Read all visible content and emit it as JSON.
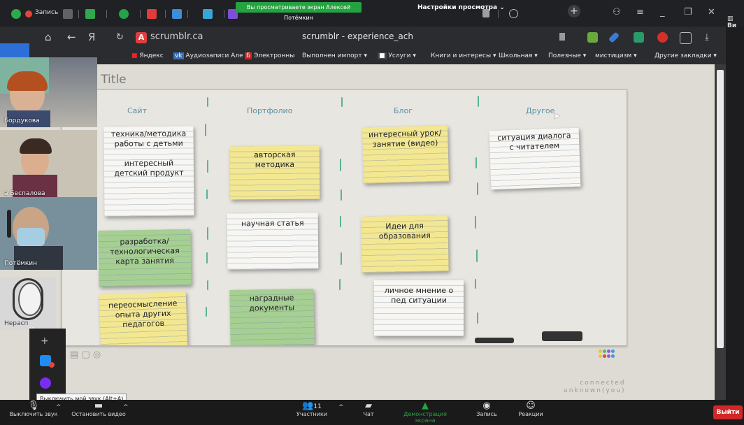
{
  "tabs": {
    "share_banner": "Вы просматриваете экран Алексей Потёмкин",
    "view_settings": "Настройки просмотра",
    "recording_tab": "Запись"
  },
  "browser": {
    "url": "scrumblr.ca",
    "page_title": "scrumblr - experience_ach",
    "right_bookmark": "Ви"
  },
  "bookmarks": {
    "items": [
      "Яндекс",
      "Аудиозаписи Але",
      "Электронны",
      "Выполнен импорт",
      "Услуги",
      "Книги и интересы",
      "Школьная",
      "Полезные",
      "мистицизм"
    ],
    "other": "Другие закладки"
  },
  "board": {
    "title": "d Title",
    "columns": [
      "Сайт",
      "Портфолио",
      "Блог",
      "Другое"
    ],
    "cards": [
      {
        "text": "техника/методика работы с детьми интересный детский продукт",
        "color": "white"
      },
      {
        "text": "разработка/ технологическая карта занятия",
        "color": "green"
      },
      {
        "text": "переосмысление опыта других педагогов",
        "color": "yellow"
      },
      {
        "text": "авторская методика",
        "color": "yellow"
      },
      {
        "text": "научная статья",
        "color": "white"
      },
      {
        "text": "наградные документы",
        "color": "green"
      },
      {
        "text": "интересный урок/ занятие (видео)",
        "color": "yellow"
      },
      {
        "text": "Идеи для образования",
        "color": "yellow"
      },
      {
        "text": "личное мнение о пед ситуации",
        "color": "white"
      },
      {
        "text": "ситуация диалога с читателем",
        "color": "white"
      }
    ],
    "card_lines": {
      "c1a": "техника/методика",
      "c1b": "работы с детьми",
      "c1c": "интересный",
      "c1d": "детский продукт",
      "c2a": "разработка/",
      "c2b": "технологическая",
      "c2c": "карта занятия",
      "c3a": "переосмысление",
      "c3b": "опыта других",
      "c3c": "педагогов",
      "c4a": "авторская",
      "c4b": "методика",
      "c5a": "научная статья",
      "c6a": "наградные",
      "c6b": "документы",
      "c7a": "интересный урок/",
      "c7b": "занятие (видео)",
      "c8a": "Идеи для",
      "c8b": "образования",
      "c9a": "личное мнение о",
      "c9b": "пед ситуации",
      "c10a": "ситуация диалога",
      "c10b": "с читателем"
    },
    "connected_line1": "connected",
    "connected_line2": "unknown(you)"
  },
  "participants": [
    {
      "name": "Бордукова"
    },
    {
      "name": "а Беспалова"
    },
    {
      "name": "Потёмкин"
    },
    {
      "name": "Нерасп"
    }
  ],
  "tooltip": "Выключить мой звук (Alt+A)",
  "zoom_bar": {
    "mute": "Выключить звук",
    "video": "Остановить видео",
    "participants": "Участники",
    "participants_count": "11",
    "chat": "Чат",
    "share": "Демонстрация экрана",
    "record": "Запись",
    "reactions": "Реакции",
    "end": "Выйти"
  },
  "colors": {
    "card_white": "#f7f6f3",
    "card_yellow": "#f3e792",
    "card_green": "#a6cf93",
    "divider": "#41a88b",
    "column_header": "#5d8fa5",
    "share_green": "#26a341",
    "end_red": "#d32626"
  }
}
